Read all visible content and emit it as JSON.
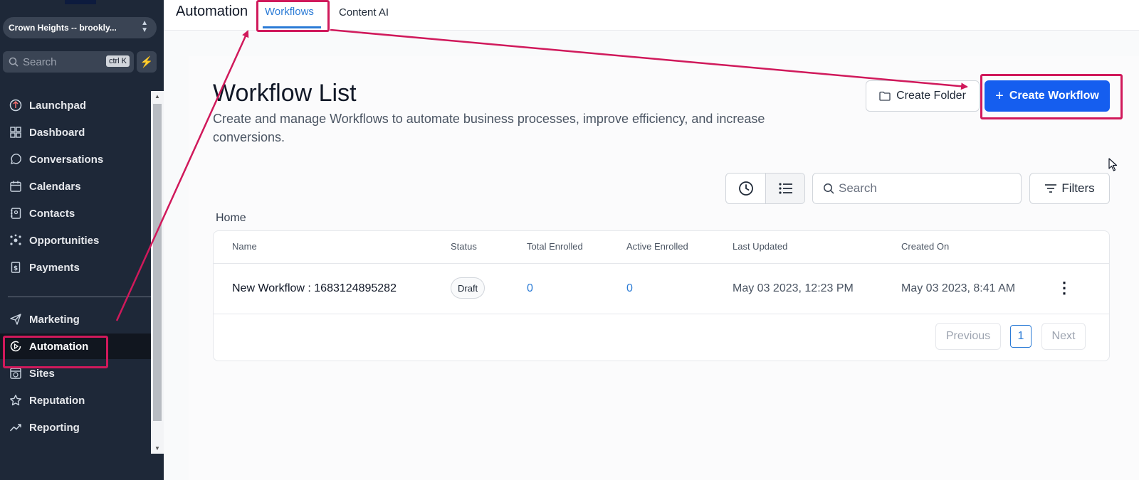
{
  "sidebar": {
    "location": "Crown Heights -- brookly...",
    "search_placeholder": "Search",
    "search_shortcut": "ctrl K",
    "items": [
      {
        "label": "Launchpad",
        "icon": "launchpad-icon"
      },
      {
        "label": "Dashboard",
        "icon": "dashboard-icon"
      },
      {
        "label": "Conversations",
        "icon": "chat-icon"
      },
      {
        "label": "Calendars",
        "icon": "calendar-icon"
      },
      {
        "label": "Contacts",
        "icon": "contacts-icon"
      },
      {
        "label": "Opportunities",
        "icon": "opportunities-icon"
      },
      {
        "label": "Payments",
        "icon": "payments-icon"
      },
      {
        "label": "Marketing",
        "icon": "send-icon"
      },
      {
        "label": "Automation",
        "icon": "automation-icon",
        "active": true
      },
      {
        "label": "Sites",
        "icon": "sites-icon"
      },
      {
        "label": "Reputation",
        "icon": "star-icon"
      },
      {
        "label": "Reporting",
        "icon": "trend-icon"
      }
    ]
  },
  "topbar": {
    "title": "Automation",
    "tabs": [
      {
        "label": "Workflows",
        "active": true
      },
      {
        "label": "Content AI",
        "active": false
      }
    ]
  },
  "main": {
    "title": "Workflow List",
    "subtitle": "Create and manage Workflows to automate business processes, improve efficiency, and increase conversions.",
    "create_folder_label": "Create Folder",
    "create_workflow_label": "Create Workflow",
    "search_placeholder": "Search",
    "filters_label": "Filters",
    "breadcrumb": "Home"
  },
  "table": {
    "columns": [
      "Name",
      "Status",
      "Total Enrolled",
      "Active Enrolled",
      "Last Updated",
      "Created On"
    ],
    "rows": [
      {
        "name": "New Workflow : 1683124895282",
        "status": "Draft",
        "total_enrolled": "0",
        "active_enrolled": "0",
        "last_updated": "May 03 2023, 12:23 PM",
        "created_on": "May 03 2023, 8:41 AM"
      }
    ],
    "pagination": {
      "previous": "Previous",
      "page": "1",
      "next": "Next"
    }
  },
  "colors": {
    "accent": "#155eef",
    "link": "#2b7bd6",
    "annotation": "#d0195b",
    "sidebar_bg": "#1e2838"
  }
}
